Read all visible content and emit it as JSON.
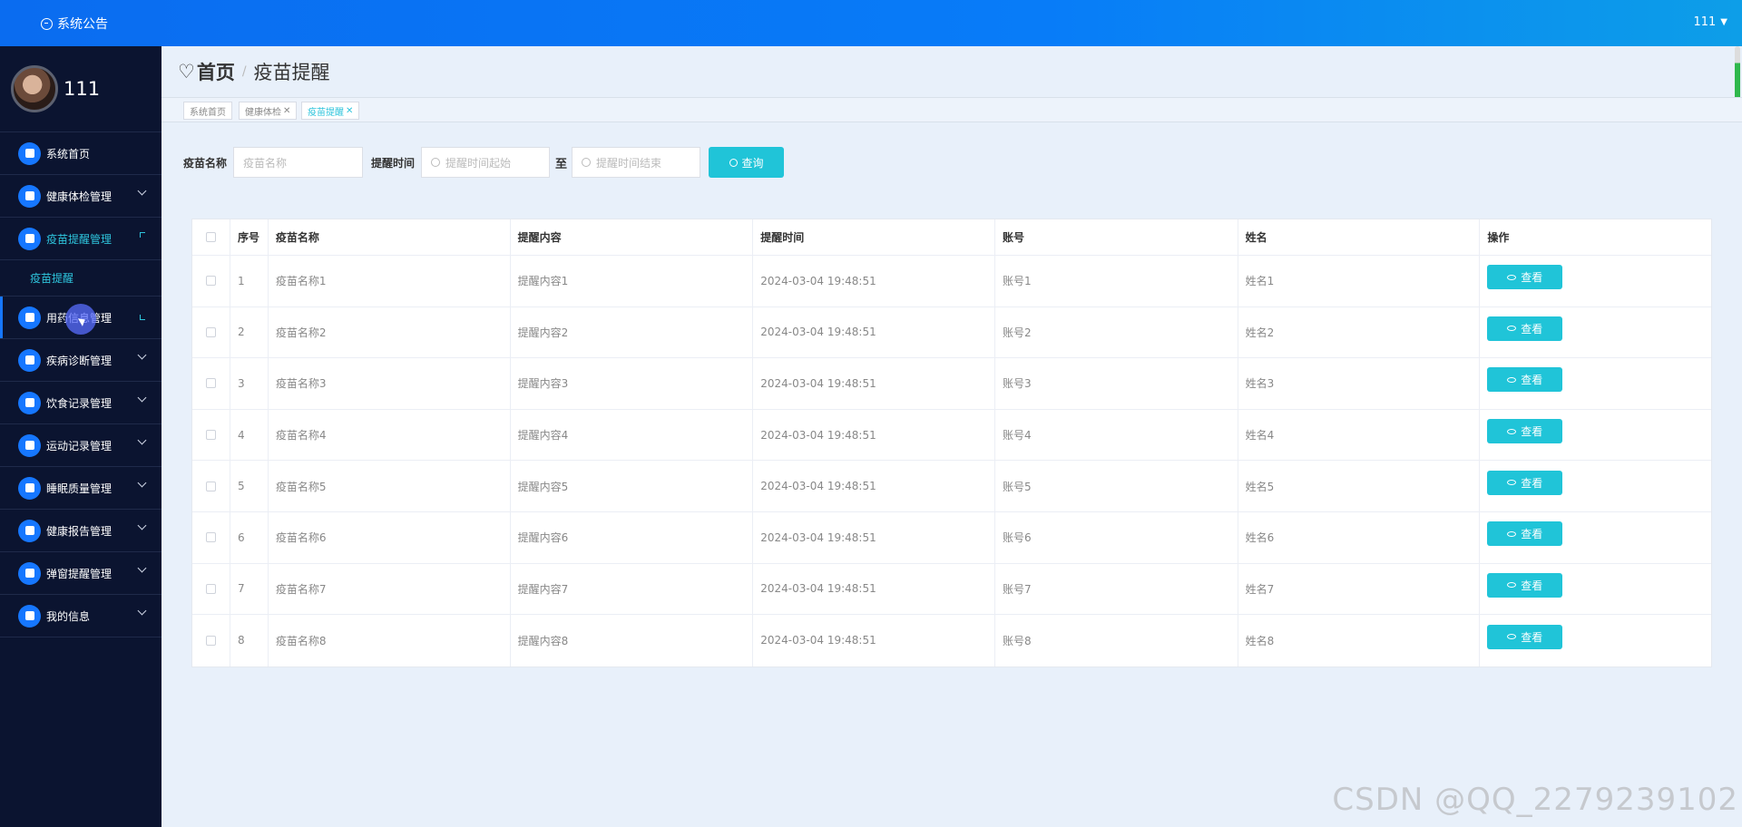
{
  "header": {
    "notice_label": "系统公告",
    "user": "111",
    "caret": "▼"
  },
  "sidebar": {
    "profile_name": "111",
    "items": [
      {
        "label": "系统首页",
        "icon": "home-icon",
        "expandable": false
      },
      {
        "label": "健康体检管理",
        "icon": "bar-chart-icon",
        "expandable": true
      },
      {
        "label": "疫苗提醒管理",
        "icon": "grid-icon",
        "expandable": true,
        "active": true
      },
      {
        "label": "用药信息管理",
        "icon": "pill-icon",
        "expandable": true
      },
      {
        "label": "疾病诊断管理",
        "icon": "grid-icon",
        "expandable": true
      },
      {
        "label": "饮食记录管理",
        "icon": "briefcase-icon",
        "expandable": true
      },
      {
        "label": "运动记录管理",
        "icon": "sliders-icon",
        "expandable": true
      },
      {
        "label": "睡眠质量管理",
        "icon": "clipboard-icon",
        "expandable": true
      },
      {
        "label": "健康报告管理",
        "icon": "grid-icon",
        "expandable": true
      },
      {
        "label": "弹窗提醒管理",
        "icon": "monitor-icon",
        "expandable": true
      },
      {
        "label": "我的信息",
        "icon": "card-icon",
        "expandable": true
      }
    ],
    "submenu": {
      "label": "疫苗提醒"
    }
  },
  "breadcrumb": {
    "icon": "heart-icon",
    "home": "首页",
    "separator": "/",
    "current": "疫苗提醒"
  },
  "tags": [
    {
      "label": "系统首页",
      "closable": false
    },
    {
      "label": "健康体检",
      "closable": true
    },
    {
      "label": "疫苗提醒",
      "closable": true,
      "active": true
    }
  ],
  "search": {
    "name_label": "疫苗名称",
    "name_placeholder": "疫苗名称",
    "time_label": "提醒时间",
    "start_placeholder": "提醒时间起始",
    "to_label": "至",
    "end_placeholder": "提醒时间结束",
    "query_button": "查询"
  },
  "table": {
    "columns": [
      "序号",
      "疫苗名称",
      "提醒内容",
      "提醒时间",
      "账号",
      "姓名",
      "操作"
    ],
    "view_label": "查看",
    "rows": [
      {
        "index": "1",
        "name": "疫苗名称1",
        "content": "提醒内容1",
        "time": "2024-03-04 19:48:51",
        "account": "账号1",
        "person": "姓名1"
      },
      {
        "index": "2",
        "name": "疫苗名称2",
        "content": "提醒内容2",
        "time": "2024-03-04 19:48:51",
        "account": "账号2",
        "person": "姓名2"
      },
      {
        "index": "3",
        "name": "疫苗名称3",
        "content": "提醒内容3",
        "time": "2024-03-04 19:48:51",
        "account": "账号3",
        "person": "姓名3"
      },
      {
        "index": "4",
        "name": "疫苗名称4",
        "content": "提醒内容4",
        "time": "2024-03-04 19:48:51",
        "account": "账号4",
        "person": "姓名4"
      },
      {
        "index": "5",
        "name": "疫苗名称5",
        "content": "提醒内容5",
        "time": "2024-03-04 19:48:51",
        "account": "账号5",
        "person": "姓名5"
      },
      {
        "index": "6",
        "name": "疫苗名称6",
        "content": "提醒内容6",
        "time": "2024-03-04 19:48:51",
        "account": "账号6",
        "person": "姓名6"
      },
      {
        "index": "7",
        "name": "疫苗名称7",
        "content": "提醒内容7",
        "time": "2024-03-04 19:48:51",
        "account": "账号7",
        "person": "姓名7"
      },
      {
        "index": "8",
        "name": "疫苗名称8",
        "content": "提醒内容8",
        "time": "2024-03-04 19:48:51",
        "account": "账号8",
        "person": "姓名8"
      }
    ]
  },
  "watermark": "CSDN @QQ_2279239102",
  "colors": {
    "topbar": "#0a6cf0",
    "sidebar": "#0b1430",
    "accent": "#20c4d8",
    "icon_bg": "#1677ff"
  }
}
